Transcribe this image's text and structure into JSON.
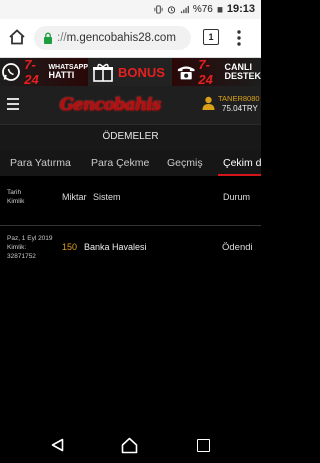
{
  "statusbar": {
    "battery": "%76",
    "time": "19:13"
  },
  "browser": {
    "url_scheme": "://",
    "url_host": "m.gencobahis28.com",
    "tab_count": "1"
  },
  "promo": {
    "whatsapp_num": "7-24",
    "whatsapp_label_1": "WHATSAPP",
    "whatsapp_label_2": "HATTI",
    "bonus_label": "BONUS",
    "live_num": "7-24",
    "live_label_1": "CANLI",
    "live_label_2": "DESTEK"
  },
  "header": {
    "logo_text": "Gencobahis",
    "username": "TANER8080",
    "balance": "75.04TRY"
  },
  "page": {
    "title": "ÖDEMELER"
  },
  "tabs": [
    {
      "label": "Para Yatırma"
    },
    {
      "label": "Para Çekme"
    },
    {
      "label": "Geçmiş"
    },
    {
      "label": "Çekim de"
    }
  ],
  "table": {
    "headers": {
      "date": "Tarih",
      "id": "Kimlik",
      "amount": "Miktar",
      "system": "Sistem",
      "status": "Durum"
    },
    "rows": [
      {
        "date": "Paz, 1 Eyl 2019",
        "id_label": "Kimlik:",
        "id": "32871752",
        "amount": "150",
        "system": "Banka Havalesi",
        "status": "Ödendi"
      }
    ]
  },
  "colors": {
    "accent_red": "#d4161b",
    "amount_gold": "#e0a020",
    "username_gold": "#d9a018"
  }
}
